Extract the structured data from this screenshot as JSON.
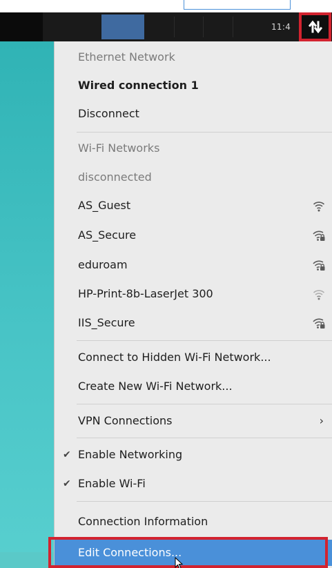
{
  "panel": {
    "clock": "11:4",
    "network_icon": "network-transfer-icon"
  },
  "menu": {
    "ethernet_header": "Ethernet Network",
    "wired_connection": "Wired connection 1",
    "disconnect": "Disconnect",
    "wifi_header": "Wi-Fi Networks",
    "wifi_status": "disconnected",
    "networks": [
      {
        "name": "AS_Guest",
        "icon": "wifi-open-icon"
      },
      {
        "name": "AS_Secure",
        "icon": "wifi-secure-icon"
      },
      {
        "name": "eduroam",
        "icon": "wifi-secure-icon"
      },
      {
        "name": "HP-Print-8b-LaserJet 300",
        "icon": "wifi-open-weak-icon"
      },
      {
        "name": "IIS_Secure",
        "icon": "wifi-secure-icon"
      }
    ],
    "connect_hidden": "Connect to Hidden Wi-Fi Network...",
    "create_new": "Create New Wi-Fi Network...",
    "vpn": "VPN Connections",
    "enable_networking": "Enable Networking",
    "enable_wifi": "Enable Wi-Fi",
    "connection_info": "Connection Information",
    "edit_connections": "Edit Connections..."
  },
  "colors": {
    "menu_bg": "#ebebeb",
    "selection": "#4a90d9",
    "annotation_red": "#d2232f",
    "panel_bg": "#1a1a1a",
    "desktop_teal": "#3fbdbf"
  }
}
